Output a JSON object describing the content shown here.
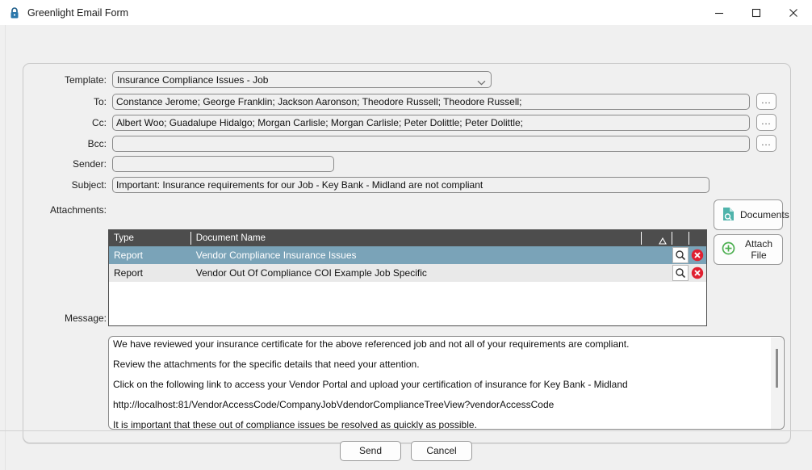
{
  "window": {
    "title": "Greenlight Email Form",
    "icon": "lock-icon",
    "minimize_label": "Minimize",
    "maximize_label": "Maximize",
    "close_label": "Close"
  },
  "form": {
    "template": {
      "label": "Template:",
      "value": "Insurance Compliance Issues - Job",
      "options": [
        "Insurance Compliance Issues - Job"
      ]
    },
    "to": {
      "label": "To:",
      "value": "Constance Jerome; George Franklin; Jackson Aaronson; Theodore Russell; Theodore Russell;",
      "browse_label": "..."
    },
    "cc": {
      "label": "Cc:",
      "value": "Albert Woo; Guadalupe Hidalgo; Morgan Carlisle; Morgan Carlisle; Peter Dolittle; Peter Dolittle;",
      "browse_label": "..."
    },
    "bcc": {
      "label": "Bcc:",
      "value": "",
      "browse_label": "..."
    },
    "sender": {
      "label": "Sender:",
      "value": ""
    },
    "subject": {
      "label": "Subject:",
      "value": "Important: Insurance requirements for our Job - Key Bank - Midland are not compliant"
    },
    "attachments": {
      "label": "Attachments:",
      "columns": [
        "Type",
        "Document Name"
      ],
      "sort_indicator": "△",
      "rows": [
        {
          "type": "Report",
          "name": "Vendor Compliance Insurance Issues",
          "selected": true,
          "view_icon": "magnifier-icon",
          "delete_icon": "delete-circle-icon"
        },
        {
          "type": "Report",
          "name": "Vendor Out Of Compliance COI Example Job Specific",
          "selected": false,
          "view_icon": "magnifier-icon",
          "delete_icon": "delete-circle-icon"
        }
      ]
    },
    "documents_button": {
      "label": "Documents",
      "icon": "document-search-icon"
    },
    "attach_button": {
      "label": "Attach File",
      "icon": "plus-circle-icon"
    },
    "message": {
      "label": "Message:",
      "paragraphs": [
        "We have reviewed your insurance certificate for the above referenced job and not all of your requirements are compliant.",
        "Review the attachments for the specific details that need your attention.",
        "Click on the following link to access your Vendor Portal and upload your certification of insurance for Key Bank - Midland",
        "http://localhost:81/VendorAccessCode/CompanyJobVdendorComplianceTreeView?vendorAccessCode",
        "It is important that these out of compliance issues be resolved as quickly as possible."
      ]
    }
  },
  "footer": {
    "send_label": "Send",
    "cancel_label": "Cancel"
  },
  "colors": {
    "selection": "#7aa3b8",
    "grid_header": "#4d4d4d",
    "delete_red": "#e02030",
    "accent_green": "#4caf50",
    "accent_teal": "#3fa9a0",
    "window_bg": "#f0f0f0"
  }
}
